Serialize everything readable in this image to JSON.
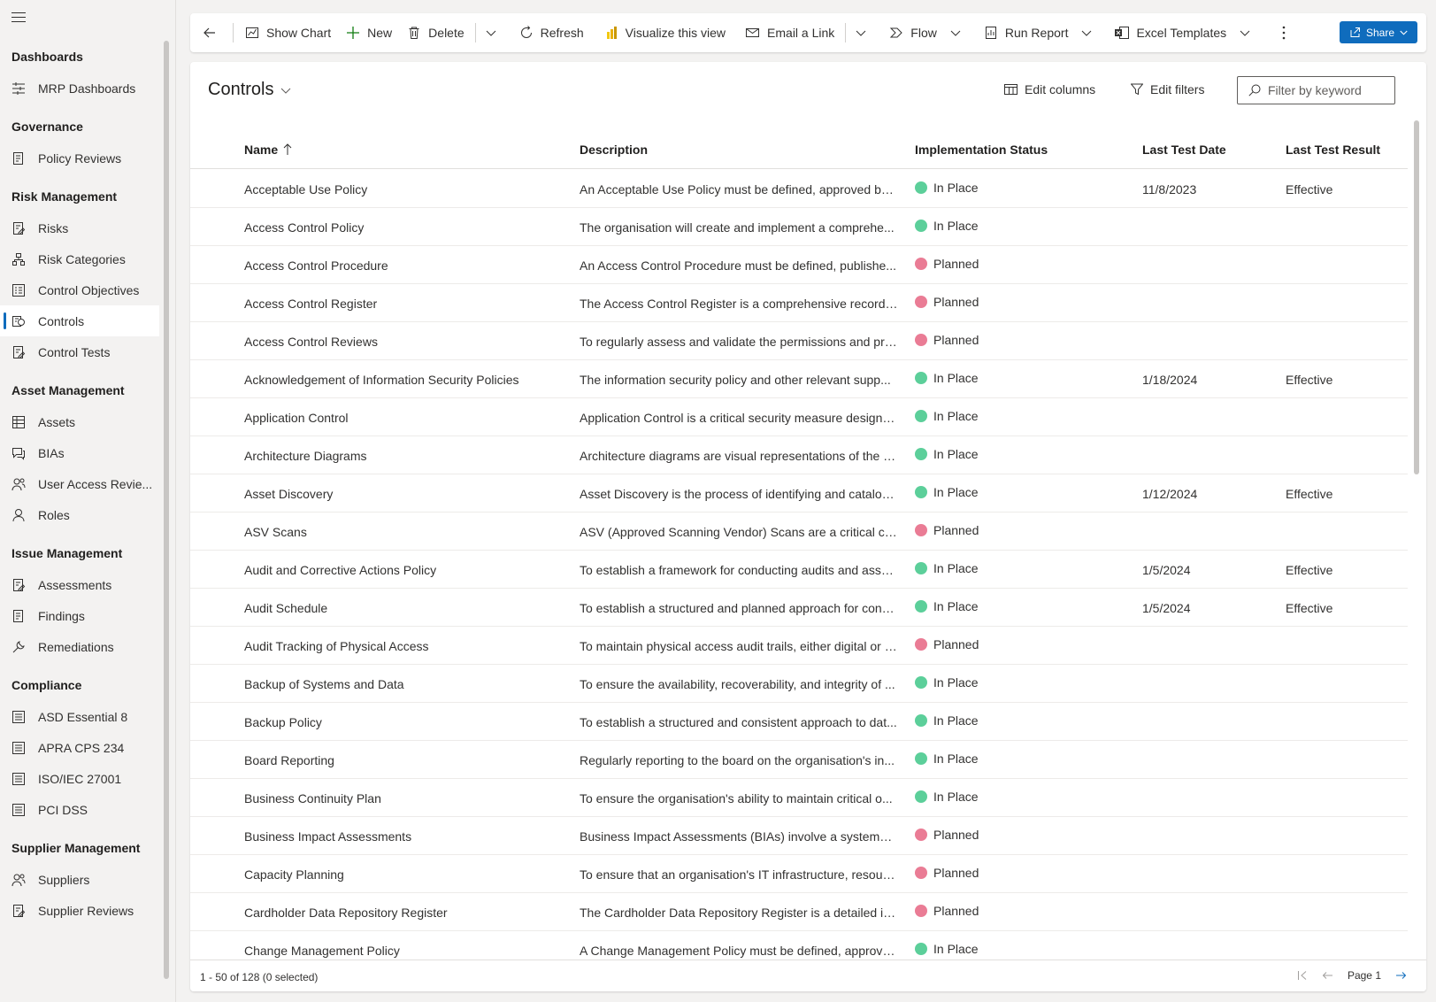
{
  "sidebar": {
    "groups": [
      {
        "title": "Dashboards",
        "items": [
          {
            "label": "MRP Dashboards",
            "icon": "dashboard-icon"
          }
        ]
      },
      {
        "title": "Governance",
        "items": [
          {
            "label": "Policy Reviews",
            "icon": "document-icon"
          }
        ]
      },
      {
        "title": "Risk Management",
        "items": [
          {
            "label": "Risks",
            "icon": "document-edit-icon"
          },
          {
            "label": "Risk Categories",
            "icon": "hierarchy-icon"
          },
          {
            "label": "Control Objectives",
            "icon": "checklist-icon"
          },
          {
            "label": "Controls",
            "icon": "controls-icon",
            "active": true
          },
          {
            "label": "Control Tests",
            "icon": "document-edit-icon"
          }
        ]
      },
      {
        "title": "Asset Management",
        "items": [
          {
            "label": "Assets",
            "icon": "table-icon"
          },
          {
            "label": "BIAs",
            "icon": "chat-icon"
          },
          {
            "label": "User Access Revie...",
            "icon": "people-icon"
          },
          {
            "label": "Roles",
            "icon": "person-icon"
          }
        ]
      },
      {
        "title": "Issue Management",
        "items": [
          {
            "label": "Assessments",
            "icon": "document-edit-icon"
          },
          {
            "label": "Findings",
            "icon": "document-icon"
          },
          {
            "label": "Remediations",
            "icon": "wrench-icon"
          }
        ]
      },
      {
        "title": "Compliance",
        "items": [
          {
            "label": "ASD Essential 8",
            "icon": "list-icon"
          },
          {
            "label": "APRA CPS 234",
            "icon": "list-icon"
          },
          {
            "label": "ISO/IEC 27001",
            "icon": "list-icon"
          },
          {
            "label": "PCI DSS",
            "icon": "list-icon"
          }
        ]
      },
      {
        "title": "Supplier Management",
        "items": [
          {
            "label": "Suppliers",
            "icon": "people-icon"
          },
          {
            "label": "Supplier Reviews",
            "icon": "document-edit-icon"
          }
        ]
      }
    ]
  },
  "toolbar": {
    "show_chart": "Show Chart",
    "new": "New",
    "delete": "Delete",
    "refresh": "Refresh",
    "visualize": "Visualize this view",
    "email_link": "Email a Link",
    "flow": "Flow",
    "run_report": "Run Report",
    "excel_templates": "Excel Templates",
    "share": "Share"
  },
  "view": {
    "title": "Controls",
    "edit_columns": "Edit columns",
    "edit_filters": "Edit filters",
    "filter_placeholder": "Filter by keyword"
  },
  "columns": {
    "name": "Name",
    "description": "Description",
    "status": "Implementation Status",
    "last_test_date": "Last Test Date",
    "last_test_result": "Last Test Result"
  },
  "status_colors": {
    "In Place": "#5ccf9a",
    "Planned": "#ea7c95"
  },
  "rows": [
    {
      "name": "Acceptable Use Policy",
      "description": "An Acceptable Use Policy must be defined, approved by ...",
      "status": "In Place",
      "date": "11/8/2023",
      "result": "Effective"
    },
    {
      "name": "Access Control Policy",
      "description": "The organisation will create and implement a comprehe...",
      "status": "In Place",
      "date": "",
      "result": ""
    },
    {
      "name": "Access Control Procedure",
      "description": "An Access Control Procedure must be defined, publishe...",
      "status": "Planned",
      "date": "",
      "result": ""
    },
    {
      "name": "Access Control Register",
      "description": "The Access Control Register is a comprehensive record t...",
      "status": "Planned",
      "date": "",
      "result": ""
    },
    {
      "name": "Access Control Reviews",
      "description": "To regularly assess and validate the permissions and priv...",
      "status": "Planned",
      "date": "",
      "result": ""
    },
    {
      "name": "Acknowledgement of Information Security Policies",
      "description": "The information security policy and other relevant supp...",
      "status": "In Place",
      "date": "1/18/2024",
      "result": "Effective"
    },
    {
      "name": "Application Control",
      "description": "Application Control is a critical security measure designe...",
      "status": "In Place",
      "date": "",
      "result": ""
    },
    {
      "name": "Architecture Diagrams",
      "description": "Architecture diagrams are visual representations of the o...",
      "status": "In Place",
      "date": "",
      "result": ""
    },
    {
      "name": "Asset Discovery",
      "description": "Asset Discovery is the process of identifying and catalog...",
      "status": "In Place",
      "date": "1/12/2024",
      "result": "Effective"
    },
    {
      "name": "ASV Scans",
      "description": "ASV (Approved Scanning Vendor) Scans are a critical co...",
      "status": "Planned",
      "date": "",
      "result": ""
    },
    {
      "name": "Audit and Corrective Actions Policy",
      "description": "To establish a framework for conducting audits and asse...",
      "status": "In Place",
      "date": "1/5/2024",
      "result": "Effective"
    },
    {
      "name": "Audit Schedule",
      "description": "To establish a structured and planned approach for cond...",
      "status": "In Place",
      "date": "1/5/2024",
      "result": "Effective"
    },
    {
      "name": "Audit Tracking of Physical Access",
      "description": "To maintain physical access audit trails, either digital or v...",
      "status": "Planned",
      "date": "",
      "result": ""
    },
    {
      "name": "Backup of Systems and Data",
      "description": "To ensure the availability, recoverability, and integrity of ...",
      "status": "In Place",
      "date": "",
      "result": ""
    },
    {
      "name": "Backup Policy",
      "description": "To establish a structured and consistent approach to dat...",
      "status": "In Place",
      "date": "",
      "result": ""
    },
    {
      "name": "Board Reporting",
      "description": "Regularly reporting to the board on the organisation's in...",
      "status": "In Place",
      "date": "",
      "result": ""
    },
    {
      "name": "Business Continuity Plan",
      "description": "To ensure the organisation's ability to maintain critical o...",
      "status": "In Place",
      "date": "",
      "result": ""
    },
    {
      "name": "Business Impact Assessments",
      "description": "Business Impact Assessments (BIAs) involve a systematic...",
      "status": "Planned",
      "date": "",
      "result": ""
    },
    {
      "name": "Capacity Planning",
      "description": "To ensure that an organisation's IT infrastructure, resourc...",
      "status": "Planned",
      "date": "",
      "result": ""
    },
    {
      "name": "Cardholder Data Repository Register",
      "description": "The Cardholder Data Repository Register is a detailed in...",
      "status": "Planned",
      "date": "",
      "result": ""
    },
    {
      "name": "Change Management Policy",
      "description": "A Change Management Policy must be defined, approve...",
      "status": "In Place",
      "date": "",
      "result": ""
    }
  ],
  "footer": {
    "count": "1 - 50 of 128 (0 selected)",
    "page": "Page 1"
  }
}
